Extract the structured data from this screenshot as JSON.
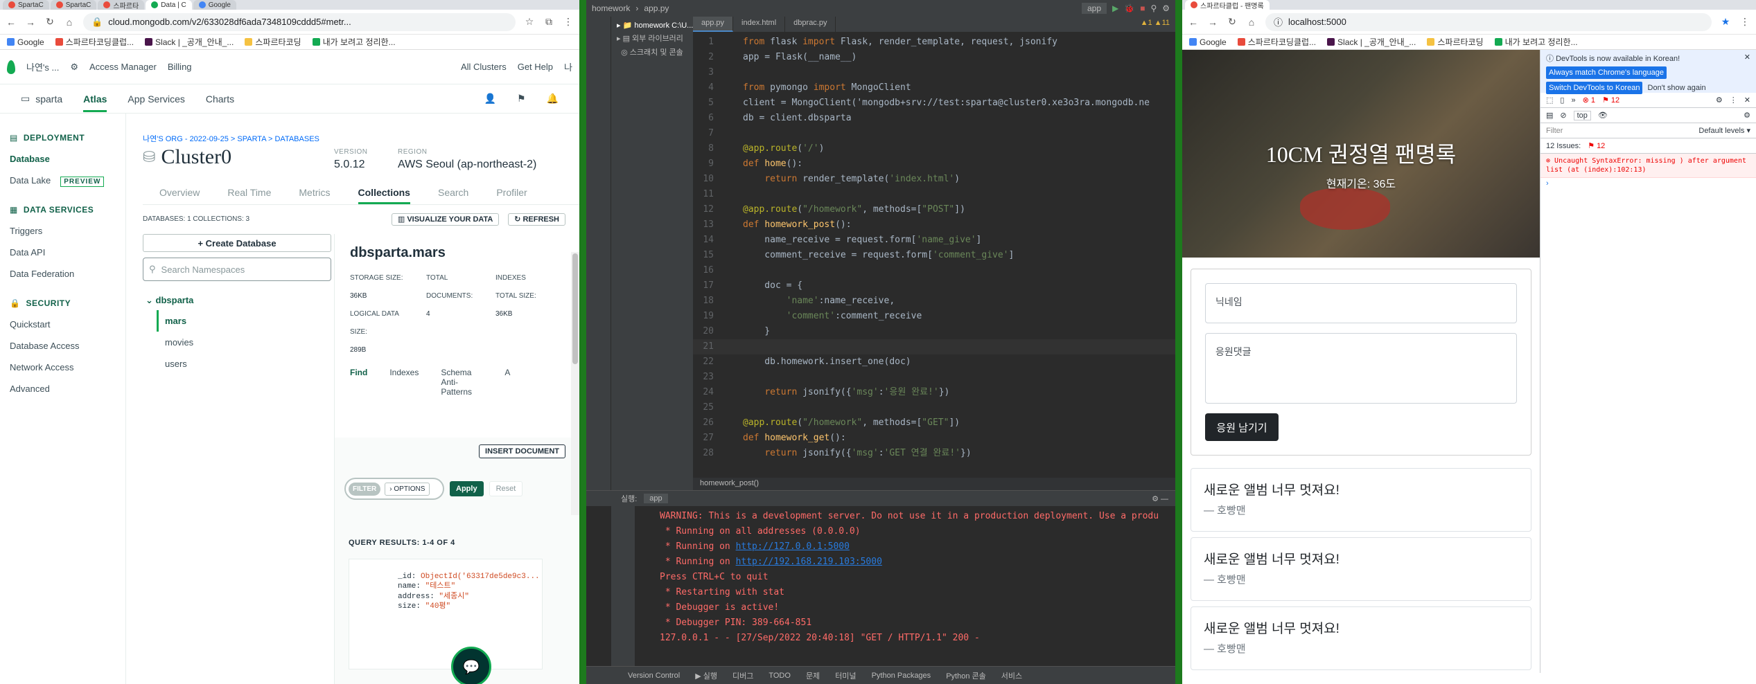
{
  "left_browser": {
    "tabs": [
      "SpartaC",
      "SpartaC",
      "스파르타",
      "Data | C",
      "Google"
    ],
    "url": "cloud.mongodb.com/v2/633028df6ada7348109cddd5#metr...",
    "bookmarks": [
      "Google",
      "스파르타코딩클럽...",
      "Slack | _공개_안내_...",
      "스파르타코딩",
      "내가 보려고 정리한..."
    ]
  },
  "atlas": {
    "org": "나연's ...",
    "access_manager": "Access Manager",
    "billing": "Billing",
    "all_clusters": "All Clusters",
    "get_help": "Get Help",
    "user": "나",
    "project": "sparta",
    "nav_tabs": [
      "Atlas",
      "App Services",
      "Charts"
    ],
    "sidebar": {
      "deployment": "DEPLOYMENT",
      "database": "Database",
      "data_lake": "Data Lake",
      "preview": "PREVIEW",
      "data_services": "DATA SERVICES",
      "triggers": "Triggers",
      "data_api": "Data API",
      "data_federation": "Data Federation",
      "security": "SECURITY",
      "quickstart": "Quickstart",
      "database_access": "Database Access",
      "network_access": "Network Access",
      "advanced": "Advanced"
    },
    "breadcrumb": "나연'S ORG - 2022-09-25 > SPARTA > DATABASES",
    "cluster": "Cluster0",
    "version_label": "VERSION",
    "version": "5.0.12",
    "region_label": "REGION",
    "region": "AWS Seoul (ap-northeast-2)",
    "cluster_tabs": [
      "Overview",
      "Real Time",
      "Metrics",
      "Collections",
      "Search",
      "Profiler"
    ],
    "databases_stat": "DATABASES: 1   COLLECTIONS: 3",
    "visualize": "VISUALIZE YOUR DATA",
    "refresh": "REFRESH",
    "create_db": "+ Create Database",
    "search_ns": "Search Namespaces",
    "db_name": "dbsparta",
    "collections": [
      "mars",
      "movies",
      "users"
    ],
    "coll_title": "dbsparta.mars",
    "storage_label": "STORAGE SIZE:",
    "storage": "36KB",
    "logical_label": "LOGICAL DATA SIZE:",
    "logical": "289B",
    "docs_label": "TOTAL DOCUMENTS:",
    "docs": "4",
    "idx_label": "INDEXES TOTAL SIZE:",
    "idx": "36KB",
    "find_tabs": [
      "Find",
      "Indexes",
      "Schema Anti-Patterns",
      "A"
    ],
    "insert_doc": "INSERT DOCUMENT",
    "filter": "FILTER",
    "options": "› OPTIONS",
    "apply": "Apply",
    "reset": "Reset",
    "query_results": "QUERY RESULTS:",
    "query_count": "1-4 OF 4",
    "doc": {
      "id_key": "_id:",
      "id_val": "ObjectId('63317de5de9c3...",
      "name_key": "name:",
      "name_val": "\"테스트\"",
      "address_key": "address:",
      "address_val": "\"세종시\"",
      "size_key": "size:",
      "size_val": "\"40평\""
    }
  },
  "ide": {
    "project": "homework",
    "file": "app.py",
    "run_config": "app",
    "tabs": [
      "app.py",
      "index.html",
      "dbprac.py"
    ],
    "tree": [
      "homework C:\\U...",
      "외부 라이브러리",
      "스크래치 및 콘솔"
    ],
    "warnings": "▲1 ▲11",
    "code": [
      {
        "n": "1",
        "t": "from flask import Flask, render_template, request, jsonify"
      },
      {
        "n": "2",
        "t": "app = Flask(__name__)"
      },
      {
        "n": "3",
        "t": ""
      },
      {
        "n": "4",
        "t": "from pymongo import MongoClient"
      },
      {
        "n": "5",
        "t": "client = MongoClient('mongodb+srv://test:sparta@cluster0.xe3o3ra.mongodb.ne"
      },
      {
        "n": "6",
        "t": "db = client.dbsparta"
      },
      {
        "n": "7",
        "t": ""
      },
      {
        "n": "8",
        "t": "@app.route('/')"
      },
      {
        "n": "9",
        "t": "def home():"
      },
      {
        "n": "10",
        "t": "    return render_template('index.html')"
      },
      {
        "n": "11",
        "t": ""
      },
      {
        "n": "12",
        "t": "@app.route(\"/homework\", methods=[\"POST\"])"
      },
      {
        "n": "13",
        "t": "def homework_post():"
      },
      {
        "n": "14",
        "t": "    name_receive = request.form['name_give']"
      },
      {
        "n": "15",
        "t": "    comment_receive = request.form['comment_give']"
      },
      {
        "n": "16",
        "t": ""
      },
      {
        "n": "17",
        "t": "    doc = {"
      },
      {
        "n": "18",
        "t": "        'name':name_receive,"
      },
      {
        "n": "19",
        "t": "        'comment':comment_receive"
      },
      {
        "n": "20",
        "t": "    }"
      },
      {
        "n": "21",
        "t": ""
      },
      {
        "n": "22",
        "t": "    db.homework.insert_one(doc)"
      },
      {
        "n": "23",
        "t": ""
      },
      {
        "n": "24",
        "t": "    return jsonify({'msg':'응원 완료!'})"
      },
      {
        "n": "25",
        "t": ""
      },
      {
        "n": "26",
        "t": "@app.route(\"/homework\", methods=[\"GET\"])"
      },
      {
        "n": "27",
        "t": "def homework_get():"
      },
      {
        "n": "28",
        "t": "    return jsonify({'msg':'GET 연결 완료!'})"
      }
    ],
    "breadcrumb": "homework_post()",
    "run_label": "실행:",
    "run_app": "app",
    "console": [
      {
        "c": "cred",
        "t": "WARNING: This is a development server. Do not use it in a production deployment. Use a produ"
      },
      {
        "c": "cred",
        "t": " * Running on all addresses (0.0.0.0)"
      },
      {
        "c": "cred",
        "t": " * Running on ",
        "link": "http://127.0.0.1:5000"
      },
      {
        "c": "cred",
        "t": " * Running on ",
        "link": "http://192.168.219.103:5000"
      },
      {
        "c": "cred",
        "t": "Press CTRL+C to quit"
      },
      {
        "c": "cred",
        "t": " * Restarting with stat"
      },
      {
        "c": "cred",
        "t": " * Debugger is active!"
      },
      {
        "c": "cred",
        "t": " * Debugger PIN: 389-664-851"
      },
      {
        "c": "cred",
        "t": "127.0.0.1 - - [27/Sep/2022 20:40:18] \"GET / HTTP/1.1\" 200 -"
      }
    ],
    "status_items": [
      "Version Control",
      "▶ 실행",
      "디버그",
      "TODO",
      "문제",
      "터미널",
      "Python Packages",
      "Python 콘솔",
      "서비스"
    ]
  },
  "right_browser": {
    "tabs": [
      "스파르타클럽 - 팬명록"
    ],
    "url": "localhost:5000",
    "bookmarks": [
      "Google",
      "스파르타코딩클럽...",
      "Slack | _공개_안내_...",
      "스파르타코딩",
      "내가 보려고 정리한..."
    ]
  },
  "site": {
    "title": "10CM 권정열 팬명록",
    "subtitle": "현재기온: 36도",
    "name_placeholder": "닉네임",
    "comment_placeholder": "응원댓글",
    "submit": "응원 남기기",
    "comments": [
      {
        "comment": "새로운 앨범 너무 멋져요!",
        "author": "— 호빵맨"
      },
      {
        "comment": "새로운 앨범 너무 멋져요!",
        "author": "— 호빵맨"
      },
      {
        "comment": "새로운 앨범 너무 멋져요!",
        "author": "— 호빵맨"
      }
    ]
  },
  "devtools": {
    "banner": "DevTools is now available in Korean!",
    "btn1": "Always match Chrome's language",
    "btn2": "Switch DevTools to Korean",
    "btn3": "Don't show again",
    "errors": "1",
    "issues_count": "12",
    "context": "top",
    "filter": "Filter",
    "levels": "Default levels ▾",
    "issues": "12 Issues:",
    "issues_badge": "12",
    "error": "Uncaught SyntaxError: missing ) after argument list (at (index):102:13)",
    "error_loc": "(index):102"
  }
}
